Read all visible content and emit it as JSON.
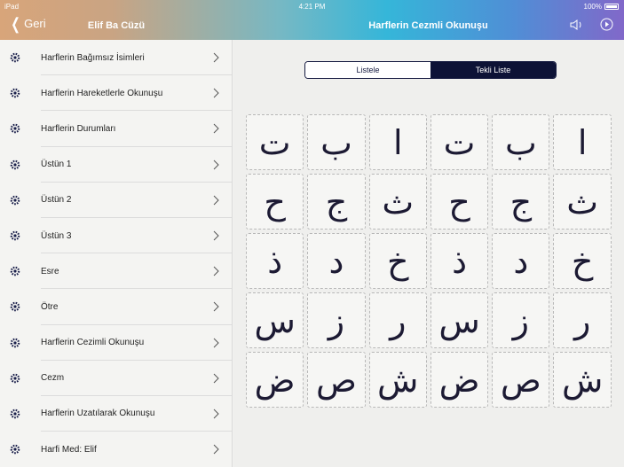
{
  "status": {
    "carrier": "iPad",
    "time": "4:21 PM",
    "battery": "100%"
  },
  "nav": {
    "back_label": "Geri",
    "left_title": "Elif Ba Cüzü",
    "right_title": "Harflerin Cezmli Okunuşu",
    "icons": [
      "speaker-icon",
      "play-icon"
    ]
  },
  "sidebar": {
    "items": [
      {
        "label": "Harflerin Bağımsız İsimleri"
      },
      {
        "label": "Harflerin Hareketlerle Okunuşu"
      },
      {
        "label": "Harflerin Durumları"
      },
      {
        "label": "Üstün 1"
      },
      {
        "label": "Üstün 2"
      },
      {
        "label": "Üstün 3"
      },
      {
        "label": "Esre"
      },
      {
        "label": "Ötre"
      },
      {
        "label": "Harflerin Cezimli Okunuşu"
      },
      {
        "label": "Cezm"
      },
      {
        "label": "Harflerin Uzatılarak Okunuşu"
      },
      {
        "label": "Harfi Med: Elif"
      }
    ]
  },
  "segment": {
    "options": [
      "Listele",
      "Tekli Liste"
    ],
    "selected": "Tekli Liste"
  },
  "letter_grid": [
    [
      "ت",
      "ب",
      "ا",
      "ت",
      "ب",
      "ا"
    ],
    [
      "ح",
      "ج",
      "ث",
      "ح",
      "ج",
      "ث"
    ],
    [
      "ذ",
      "د",
      "خ",
      "ذ",
      "د",
      "خ"
    ],
    [
      "س",
      "ز",
      "ر",
      "س",
      "ز",
      "ر"
    ],
    [
      "ض",
      "ص",
      "ش",
      "ض",
      "ص",
      "ش"
    ]
  ],
  "colors": {
    "accent_dark": "#0d1236",
    "letter": "#1c1a33"
  }
}
